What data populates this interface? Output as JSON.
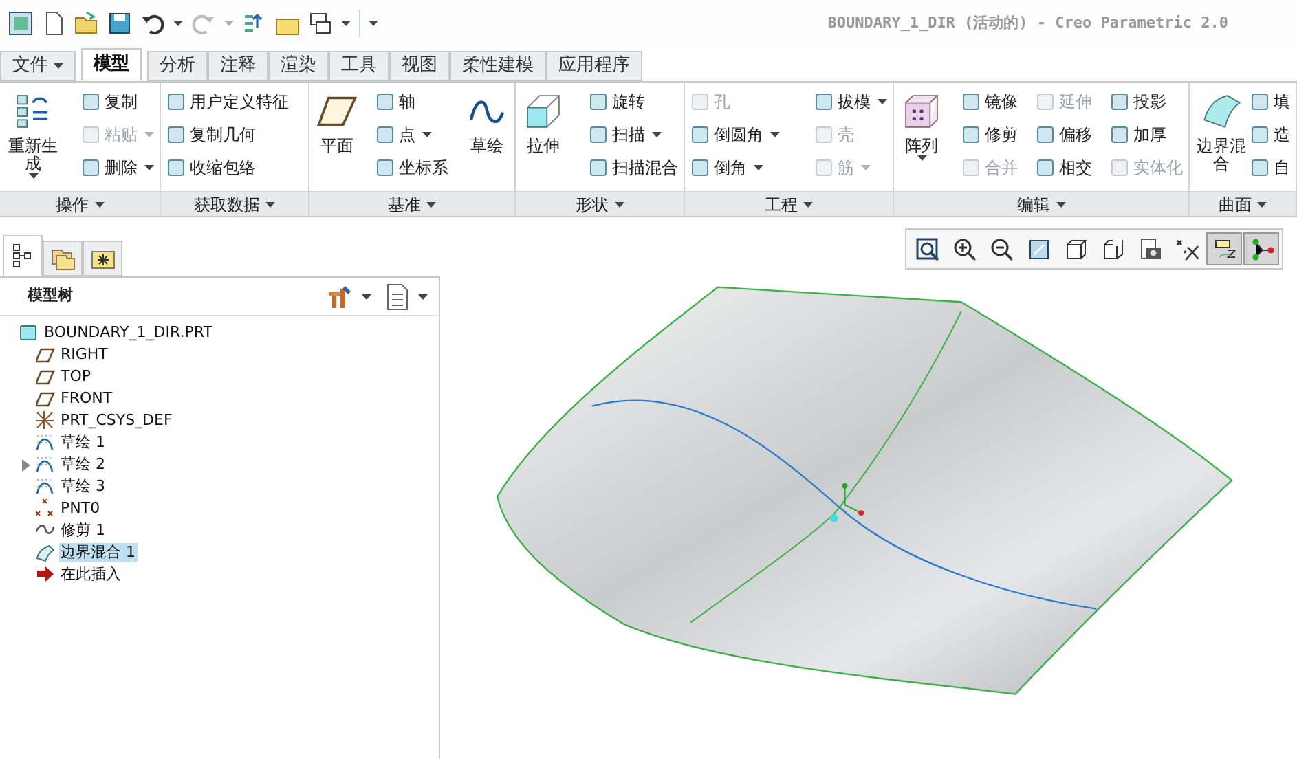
{
  "window": {
    "title": "BOUNDARY_1_DIR (活动的) - Creo Parametric 2.0"
  },
  "tabs": [
    {
      "label": "文件",
      "selected": false,
      "menu": true
    },
    {
      "label": "模型",
      "selected": true,
      "menu": false
    },
    {
      "label": "分析",
      "selected": false,
      "menu": false
    },
    {
      "label": "注释",
      "selected": false,
      "menu": false
    },
    {
      "label": "渲染",
      "selected": false,
      "menu": false
    },
    {
      "label": "工具",
      "selected": false,
      "menu": false
    },
    {
      "label": "视图",
      "selected": false,
      "menu": false
    },
    {
      "label": "柔性建模",
      "selected": false,
      "menu": false
    },
    {
      "label": "应用程序",
      "selected": false,
      "menu": false
    }
  ],
  "ribbon": [
    {
      "label": "操作",
      "columns": [
        {
          "kind": "large",
          "items": [
            {
              "label": "重新生成",
              "disabled": false,
              "menu": true
            }
          ]
        },
        {
          "kind": "small",
          "items": [
            {
              "label": "复制",
              "disabled": false,
              "menu": false
            },
            {
              "label": "粘贴",
              "disabled": true,
              "menu": true
            },
            {
              "label": "删除",
              "disabled": false,
              "menu": true
            }
          ]
        }
      ]
    },
    {
      "label": "获取数据",
      "columns": [
        {
          "kind": "small",
          "items": [
            {
              "label": "用户定义特征",
              "disabled": false,
              "menu": false
            },
            {
              "label": "复制几何",
              "disabled": false,
              "menu": false
            },
            {
              "label": "收缩包络",
              "disabled": false,
              "menu": false
            }
          ]
        }
      ]
    },
    {
      "label": "基准",
      "columns": [
        {
          "kind": "large",
          "items": [
            {
              "label": "平面",
              "disabled": false,
              "menu": false
            }
          ]
        },
        {
          "kind": "small",
          "items": [
            {
              "label": "轴",
              "disabled": false,
              "menu": false
            },
            {
              "label": "点",
              "disabled": false,
              "menu": true
            },
            {
              "label": "坐标系",
              "disabled": false,
              "menu": false
            }
          ]
        },
        {
          "kind": "large",
          "items": [
            {
              "label": "草绘",
              "disabled": false,
              "menu": false
            }
          ]
        }
      ]
    },
    {
      "label": "形状",
      "columns": [
        {
          "kind": "large",
          "items": [
            {
              "label": "拉伸",
              "disabled": false,
              "menu": false
            }
          ]
        },
        {
          "kind": "small",
          "items": [
            {
              "label": "旋转",
              "disabled": false,
              "menu": false
            },
            {
              "label": "扫描",
              "disabled": false,
              "menu": true
            },
            {
              "label": "扫描混合",
              "disabled": false,
              "menu": false
            }
          ]
        }
      ]
    },
    {
      "label": "工程",
      "columns": [
        {
          "kind": "small",
          "items": [
            {
              "label": "孔",
              "disabled": true,
              "menu": false
            },
            {
              "label": "倒圆角",
              "disabled": false,
              "menu": true
            },
            {
              "label": "倒角",
              "disabled": false,
              "menu": true
            }
          ]
        },
        {
          "kind": "small",
          "items": [
            {
              "label": "拔模",
              "disabled": false,
              "menu": true
            },
            {
              "label": "壳",
              "disabled": true,
              "menu": false
            },
            {
              "label": "筋",
              "disabled": true,
              "menu": true
            }
          ]
        }
      ]
    },
    {
      "label": "编辑",
      "columns": [
        {
          "kind": "large",
          "items": [
            {
              "label": "阵列",
              "disabled": false,
              "menu": true
            }
          ]
        },
        {
          "kind": "small",
          "items": [
            {
              "label": "镜像",
              "disabled": false,
              "menu": false
            },
            {
              "label": "修剪",
              "disabled": false,
              "menu": false
            },
            {
              "label": "合并",
              "disabled": true,
              "menu": false
            }
          ]
        },
        {
          "kind": "small",
          "items": [
            {
              "label": "延伸",
              "disabled": true,
              "menu": false
            },
            {
              "label": "偏移",
              "disabled": false,
              "menu": false
            },
            {
              "label": "相交",
              "disabled": false,
              "menu": false
            }
          ]
        },
        {
          "kind": "small",
          "items": [
            {
              "label": "投影",
              "disabled": false,
              "menu": false
            },
            {
              "label": "加厚",
              "disabled": false,
              "menu": false
            },
            {
              "label": "实体化",
              "disabled": true,
              "menu": false
            }
          ]
        }
      ]
    },
    {
      "label": "曲面",
      "columns": [
        {
          "kind": "large",
          "items": [
            {
              "label": "边界混合",
              "disabled": false,
              "menu": false
            }
          ]
        },
        {
          "kind": "small",
          "items": [
            {
              "label": "填",
              "disabled": false,
              "menu": false
            },
            {
              "label": "造",
              "disabled": false,
              "menu": false
            },
            {
              "label": "自",
              "disabled": false,
              "menu": false
            }
          ]
        }
      ]
    }
  ],
  "panel_tabs": [
    {
      "selected": true
    },
    {
      "selected": false
    },
    {
      "selected": false
    }
  ],
  "model_tree": {
    "title": "模型树",
    "root": {
      "label": "BOUNDARY_1_DIR.PRT",
      "kind": "part",
      "selected": false,
      "expandable": false,
      "children": [
        {
          "label": "RIGHT",
          "kind": "plane",
          "selected": false,
          "expandable": false
        },
        {
          "label": "TOP",
          "kind": "plane",
          "selected": false,
          "expandable": false
        },
        {
          "label": "FRONT",
          "kind": "plane",
          "selected": false,
          "expandable": false
        },
        {
          "label": "PRT_CSYS_DEF",
          "kind": "csys",
          "selected": false,
          "expandable": false
        },
        {
          "label": "草绘 1",
          "kind": "sketch",
          "selected": false,
          "expandable": false
        },
        {
          "label": "草绘 2",
          "kind": "sketch",
          "selected": false,
          "expandable": true
        },
        {
          "label": "草绘 3",
          "kind": "sketch",
          "selected": false,
          "expandable": false
        },
        {
          "label": "PNT0",
          "kind": "point",
          "selected": false,
          "expandable": false
        },
        {
          "label": "修剪 1",
          "kind": "curve",
          "selected": false,
          "expandable": false
        },
        {
          "label": "边界混合 1",
          "kind": "boundary",
          "selected": true,
          "expandable": false
        },
        {
          "label": "在此插入",
          "kind": "insert",
          "selected": false,
          "expandable": false
        }
      ]
    }
  },
  "view_toolbar": [
    {
      "on": false
    },
    {
      "on": false
    },
    {
      "on": false
    },
    {
      "on": false
    },
    {
      "on": false
    },
    {
      "on": false
    },
    {
      "on": false
    },
    {
      "on": false
    },
    {
      "on": true
    },
    {
      "on": true
    }
  ]
}
